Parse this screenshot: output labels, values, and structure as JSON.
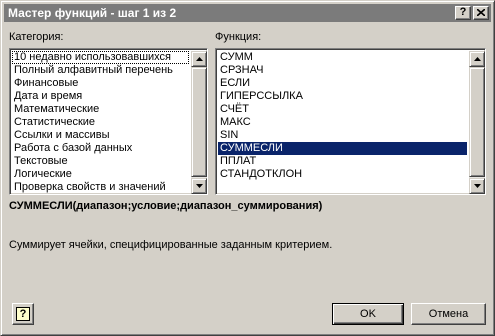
{
  "window": {
    "title": "Мастер функций - шаг 1 из 2",
    "help_button": "?",
    "close_button": "X"
  },
  "category": {
    "label": "Категория:",
    "items": [
      "10 недавно использовавшихся",
      "Полный алфавитный перечень",
      "Финансовые",
      "Дата и время",
      "Математические",
      "Статистические",
      "Ссылки и массивы",
      "Работа с базой данных",
      "Текстовые",
      "Логические",
      "Проверка свойств и значений"
    ],
    "selected": "10 недавно использовавшихся"
  },
  "function": {
    "label": "Функция:",
    "items": [
      "СУММ",
      "СРЗНАЧ",
      "ЕСЛИ",
      "ГИПЕРССЫЛКА",
      "СЧЁТ",
      "МАКС",
      "SIN",
      "СУММЕСЛИ",
      "ППЛАТ",
      "СТАНДОТКЛОН"
    ],
    "selected": "СУММЕСЛИ"
  },
  "syntax": "СУММЕСЛИ(диапазон;условие;диапазон_суммирования)",
  "description": "Суммирует ячейки, специфицированные заданным критерием.",
  "buttons": {
    "help": "?",
    "ok": "OK",
    "cancel": "Отмена"
  },
  "colors": {
    "dialog_bg": "#d4d0c8",
    "title_bar": "#7b7b7b",
    "selection": "#0a246a"
  }
}
